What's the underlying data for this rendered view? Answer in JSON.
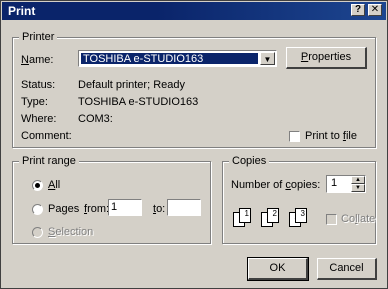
{
  "window": {
    "title": "Print"
  },
  "titlebar": {
    "help_glyph": "?",
    "close_glyph": "✕"
  },
  "printer": {
    "group_label": "Printer",
    "name_label": "Name:",
    "name_value": "TOSHIBA e-STUDIO163",
    "properties_label": "Properties",
    "status_label": "Status:",
    "status_value": "Default printer; Ready",
    "type_label": "Type:",
    "type_value": "TOSHIBA e-STUDIO163",
    "where_label": "Where:",
    "where_value": "COM3:",
    "comment_label": "Comment:",
    "print_to_file_label": "Print to file",
    "print_to_file_checked": false
  },
  "print_range": {
    "group_label": "Print range",
    "all_label": "All",
    "pages_label": "Pages",
    "from_label": "from:",
    "from_value": "1",
    "to_label": "to:",
    "to_value": "",
    "selection_label": "Selection",
    "selected": "all"
  },
  "copies": {
    "group_label": "Copies",
    "number_label": "Number of copies:",
    "number_value": "1",
    "collate_label": "Collate",
    "collate_checked": false,
    "collate_pages": [
      {
        "back": "1",
        "front": "1"
      },
      {
        "back": "2",
        "front": "2"
      },
      {
        "back": "3",
        "front": "3"
      }
    ]
  },
  "buttons": {
    "ok_label": "OK",
    "cancel_label": "Cancel"
  },
  "colors": {
    "title_bar": "#0a246a",
    "selection": "#0a246a",
    "face": "#d4d0c8"
  }
}
